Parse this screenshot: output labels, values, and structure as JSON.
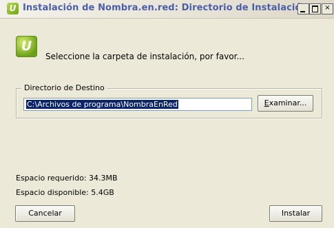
{
  "window": {
    "title": "Instalación de Nombra.en.red: Directorio de Instalación",
    "controls": {
      "minimize": "_",
      "maximize": "□",
      "close": "×"
    }
  },
  "header": {
    "logo_icon": "nombra-logo-icon",
    "prompt": "Seleccione la carpeta de instalación, por favor..."
  },
  "destination": {
    "legend": "Directorio de Destino",
    "path_value": "C:\\Archivos de programa\\NombraEnRed",
    "browse_label": "Examinar..."
  },
  "space": {
    "required": "Espacio requerido: 34.3MB",
    "available": "Espacio disponible: 5.4GB"
  },
  "footer": {
    "cancel_label": "Cancelar",
    "install_label": "Instalar"
  },
  "colors": {
    "title_text": "#4b5fa8",
    "selection": "#0a246a",
    "logo_green": "#7cb21f"
  }
}
